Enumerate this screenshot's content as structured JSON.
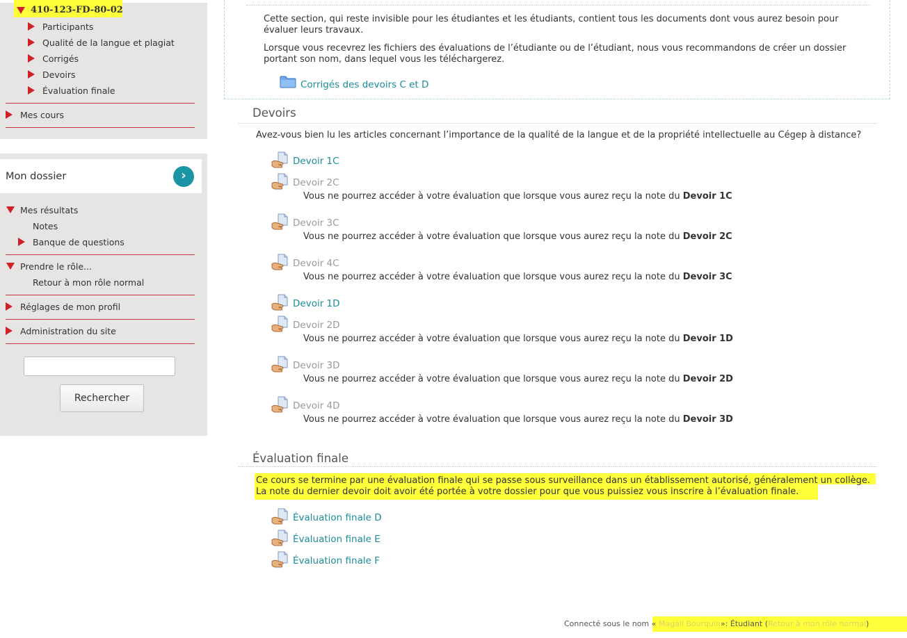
{
  "nav": {
    "course_code": "410-123-FD-80-02",
    "course_items": [
      {
        "label": "Participants"
      },
      {
        "label": "Qualité de la langue et plagiat"
      },
      {
        "label": "Corrigés"
      },
      {
        "label": "Devoirs"
      },
      {
        "label": "Évaluation finale"
      }
    ],
    "my_courses": "Mes cours"
  },
  "dossier": {
    "title": "Mon dossier",
    "go_icon": "chevron-right-icon",
    "results": "Mes résultats",
    "grades": "Notes",
    "question_bank": "Banque de questions",
    "role_switch": "Prendre le rôle...",
    "return_role": "Retour à mon rôle normal",
    "profile_settings": "Réglages de mon profil",
    "site_admin": "Administration du site",
    "search_placeholder": "",
    "search_button": "Rechercher"
  },
  "corriges_section": {
    "para1": "Cette section, qui reste invisible pour les étudiantes et les étudiants, contient tous les documents dont vous aurez besoin pour évaluer leurs travaux.",
    "para2": "Lorsque vous recevrez les fichiers des évaluations de l’étudiante ou de l’étudiant, nous vous recommandons de créer un dossier portant son nom, dans lequel vous les téléchargerez.",
    "folder_link": "Corrigés des devoirs C et D",
    "folder_icon": "folder-icon"
  },
  "devoirs_section": {
    "title": "Devoirs",
    "intro": "Avez-vous bien lu les articles concernant l’importance de la qualité de la langue et de la propriété intellectuelle au Cégep à distance?",
    "restriction_prefix": "Vous ne pourrez accéder à votre évaluation que lorsque vous aurez reçu la note du",
    "activity_icon": "assignment-icon",
    "items": [
      {
        "label": "Devoir 1C",
        "available": true,
        "requires": ""
      },
      {
        "label": "Devoir 2C",
        "available": false,
        "requires": "Devoir 1C"
      },
      {
        "label": "Devoir 3C",
        "available": false,
        "requires": "Devoir 2C"
      },
      {
        "label": "Devoir 4C",
        "available": false,
        "requires": "Devoir 3C"
      },
      {
        "label": "Devoir 1D",
        "available": true,
        "requires": ""
      },
      {
        "label": "Devoir 2D",
        "available": false,
        "requires": "Devoir 1D"
      },
      {
        "label": "Devoir 3D",
        "available": false,
        "requires": "Devoir 2D"
      },
      {
        "label": "Devoir 4D",
        "available": false,
        "requires": "Devoir 3D"
      }
    ]
  },
  "final_section": {
    "title": "Évaluation finale",
    "line1": "Ce cours se termine par une évaluation finale qui se passe sous surveillance dans un établissement autorisé, généralement un collège.",
    "line2": "La note du dernier devoir doit avoir été portée à votre dossier pour que vous puissiez vous inscrire à l’évaluation finale.",
    "items": [
      "Évaluation finale D",
      "Évaluation finale E",
      "Évaluation finale F"
    ]
  },
  "footer": {
    "prefix": "Connecté sous le nom «",
    "user": "Magali Bourquin",
    "role_text": "»: Étudiant (",
    "return_link": "Retour à mon rôle normal",
    "suffix": ")"
  },
  "colors": {
    "highlight": "#ffff3a",
    "link": "#1a8d9a",
    "nav_marker": "#d0212a",
    "go_button": "#1a95a6"
  }
}
